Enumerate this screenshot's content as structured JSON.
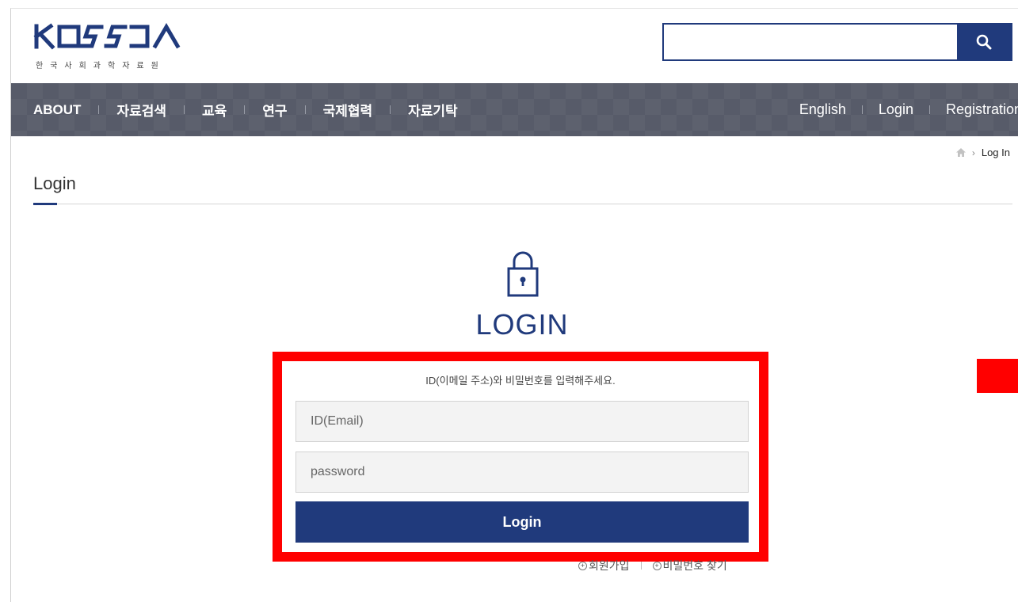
{
  "header": {
    "logo_text": "KOSSDA",
    "logo_subtitle": "한국사회과학자료원",
    "search": {
      "value": "",
      "placeholder": ""
    }
  },
  "nav": {
    "left": [
      "ABOUT",
      "자료검색",
      "교육",
      "연구",
      "국제협력",
      "자료기탁"
    ],
    "right": [
      "English",
      "Login",
      "Registration"
    ]
  },
  "breadcrumb": {
    "current": "Log In"
  },
  "page_title": "Login",
  "login": {
    "heading": "LOGIN",
    "instruction": "ID(이메일 주소)와 비밀번호를 입력해주세요.",
    "id_placeholder": "ID(Email)",
    "password_placeholder": "password",
    "button_label": "Login",
    "links": [
      "회원가입",
      "비밀번호 찾기"
    ]
  },
  "colors": {
    "primary": "#203a7c",
    "nav_bg": "#575b69",
    "highlight": "#ff0000"
  }
}
